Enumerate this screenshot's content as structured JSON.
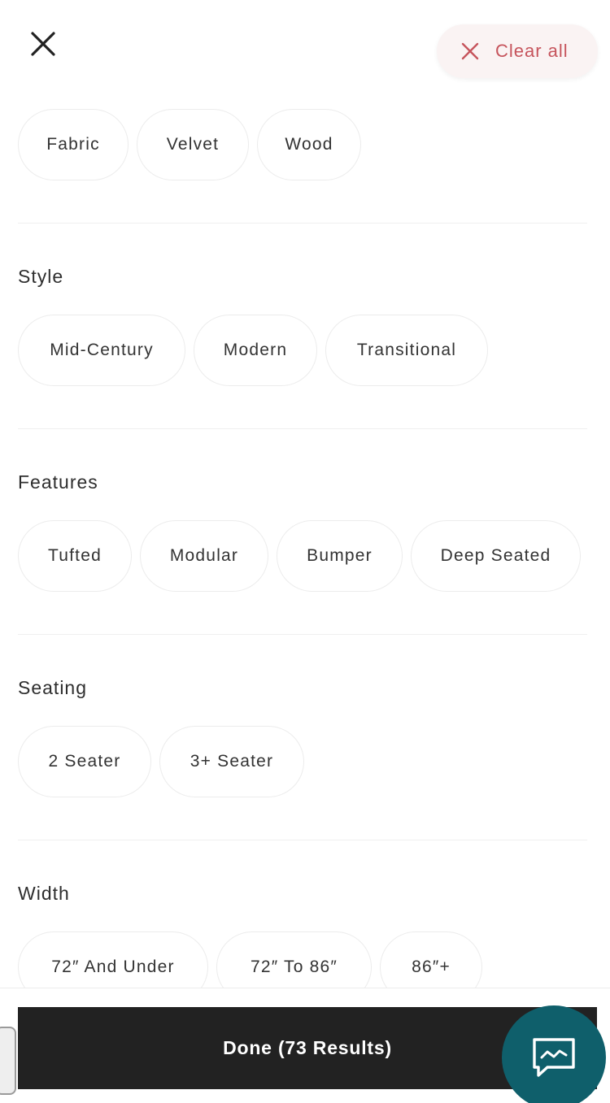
{
  "header": {
    "close_icon": "close-icon",
    "clear_all_label": "Clear all",
    "clear_icon": "close-icon",
    "accent_color": "#c6545c"
  },
  "material": {
    "options": [
      "Fabric",
      "Velvet",
      "Wood"
    ]
  },
  "style": {
    "title": "Style",
    "options": [
      "Mid-Century",
      "Modern",
      "Transitional"
    ]
  },
  "features": {
    "title": "Features",
    "options": [
      "Tufted",
      "Modular",
      "Bumper",
      "Deep Seated"
    ]
  },
  "seating": {
    "title": "Seating",
    "options": [
      "2 Seater",
      "3+ Seater"
    ]
  },
  "width": {
    "title": "Width",
    "options": [
      "72″ And Under",
      "72″ To 86″",
      "86″+"
    ]
  },
  "footer": {
    "done_label": "Done (73 Results)",
    "chat_icon": "chat-icon",
    "chat_color": "#0f5f6b"
  }
}
